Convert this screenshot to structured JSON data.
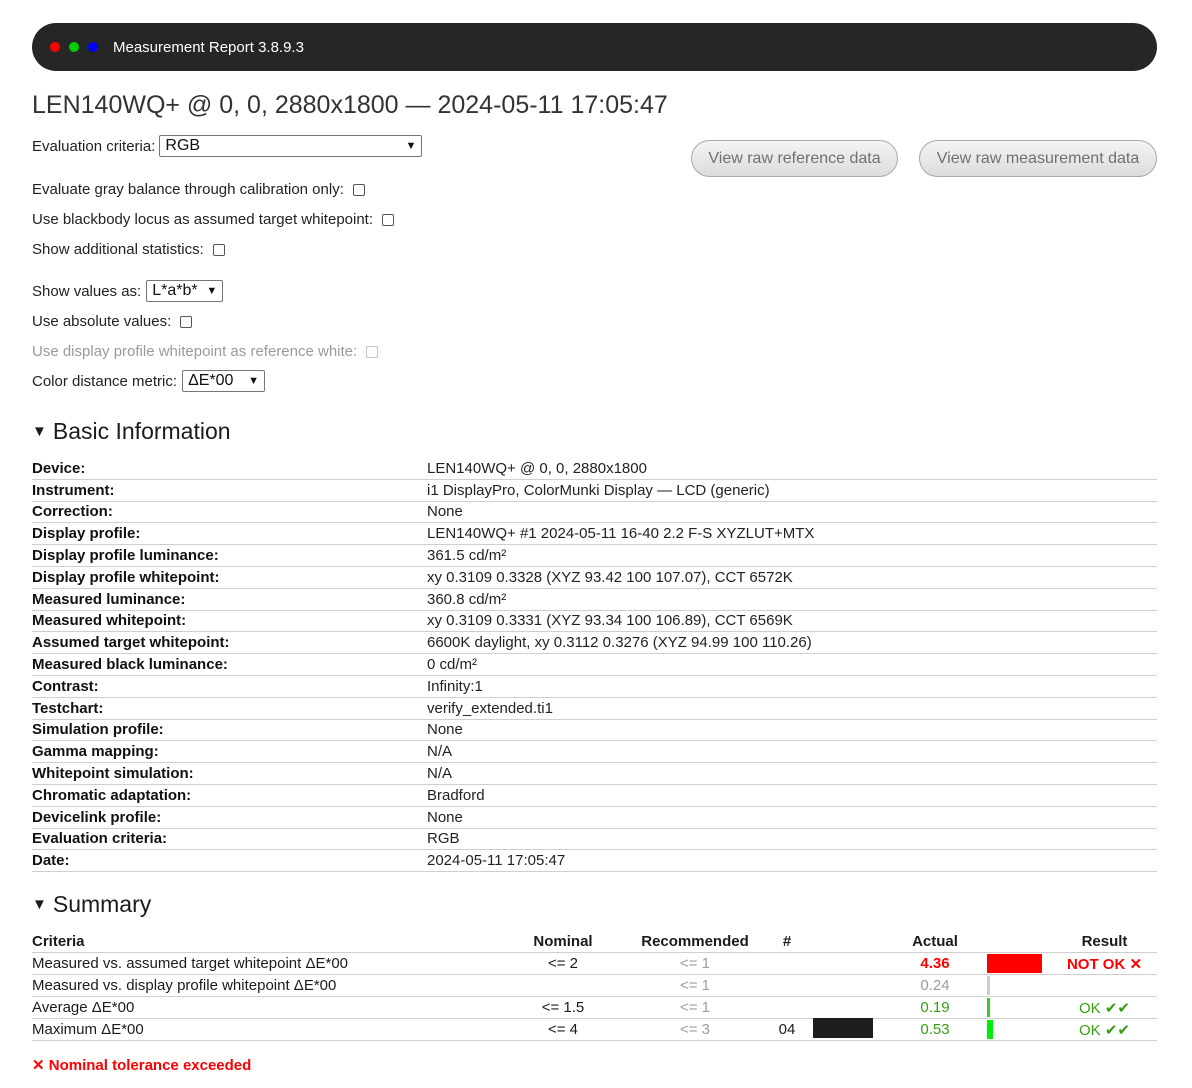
{
  "titlebar": {
    "dot_colors": [
      "#ff0000",
      "#00cc00",
      "#0000ff"
    ],
    "text": "Measurement Report 3.8.9.3"
  },
  "page_title": "LEN140WQ+ @ 0, 0, 2880x1800 — 2024-05-11 17:05:47",
  "controls": {
    "evaluation_criteria_label": "Evaluation criteria:",
    "evaluation_criteria_value": "RGB",
    "gray_balance_label": "Evaluate gray balance through calibration only:",
    "blackbody_label": "Use blackbody locus as assumed target whitepoint:",
    "additional_stats_label": "Show additional statistics:",
    "show_values_label": "Show values as:",
    "show_values_value": "L*a*b*",
    "absolute_label": "Use absolute values:",
    "profile_whitepoint_label": "Use display profile whitepoint as reference white:",
    "distance_metric_label": "Color distance metric:",
    "distance_metric_value": "ΔE*00",
    "view_reference_button": "View raw reference data",
    "view_measurement_button": "View raw measurement data"
  },
  "basic_info": {
    "heading": "Basic Information",
    "rows": [
      {
        "key": "Device:",
        "value": "LEN140WQ+ @ 0, 0, 2880x1800"
      },
      {
        "key": "Instrument:",
        "value": "i1 DisplayPro, ColorMunki Display — LCD (generic)"
      },
      {
        "key": "Correction:",
        "value": "None"
      },
      {
        "key": "Display profile:",
        "value": "LEN140WQ+ #1 2024-05-11 16-40 2.2 F-S XYZLUT+MTX"
      },
      {
        "key": "Display profile luminance:",
        "value": "361.5 cd/m²"
      },
      {
        "key": "Display profile whitepoint:",
        "value": "xy 0.3109 0.3328 (XYZ 93.42 100 107.07), CCT 6572K"
      },
      {
        "key": "Measured luminance:",
        "value": "360.8 cd/m²"
      },
      {
        "key": "Measured whitepoint:",
        "value": "xy 0.3109 0.3331 (XYZ 93.34 100 106.89), CCT 6569K"
      },
      {
        "key": "Assumed target whitepoint:",
        "value": "6600K daylight, xy 0.3112 0.3276 (XYZ 94.99 100 110.26)"
      },
      {
        "key": "Measured black luminance:",
        "value": "0 cd/m²"
      },
      {
        "key": "Contrast:",
        "value": "Infinity:1"
      },
      {
        "key": "Testchart:",
        "value": "verify_extended.ti1"
      },
      {
        "key": "Simulation profile:",
        "value": "None"
      },
      {
        "key": "Gamma mapping:",
        "value": "N/A"
      },
      {
        "key": "Whitepoint simulation:",
        "value": "N/A"
      },
      {
        "key": "Chromatic adaptation:",
        "value": "Bradford"
      },
      {
        "key": "Devicelink profile:",
        "value": "None"
      },
      {
        "key": "Evaluation criteria:",
        "value": "RGB"
      },
      {
        "key": "Date:",
        "value": "2024-05-11 17:05:47"
      }
    ]
  },
  "summary": {
    "heading": "Summary",
    "headers": {
      "criteria": "Criteria",
      "nominal": "Nominal",
      "recommended": "Recommended",
      "number": "#",
      "actual": "Actual",
      "result": "Result"
    },
    "rows": [
      {
        "criteria": "Measured vs. assumed target whitepoint ΔE*00",
        "nominal": "<= 2",
        "recommended": "<= 1",
        "number": "",
        "actual": "4.36",
        "result": "NOT OK ✕",
        "status": "bad",
        "bar_fraction": 1.0,
        "bar_color": "#ff0000"
      },
      {
        "criteria": "Measured vs. display profile whitepoint ΔE*00",
        "nominal": "",
        "recommended": "<= 1",
        "number": "",
        "actual": "0.24",
        "result": "",
        "status": "neutral",
        "bar_fraction": 0.05,
        "bar_color": "#cccccc"
      },
      {
        "criteria": "Average ΔE*00",
        "nominal": "<= 1.5",
        "recommended": "<= 1",
        "number": "",
        "actual": "0.19",
        "result": "OK ✔✔",
        "status": "good",
        "bar_fraction": 0.04,
        "bar_color": "#33cc33"
      },
      {
        "criteria": "Maximum ΔE*00",
        "nominal": "<= 4",
        "recommended": "<= 3",
        "number": "04",
        "actual": "0.53",
        "result": "OK ✔✔",
        "status": "good",
        "bar_fraction": 0.11,
        "bar_color": "#00ee00"
      }
    ],
    "footnote": "✕ Nominal tolerance exceeded"
  }
}
